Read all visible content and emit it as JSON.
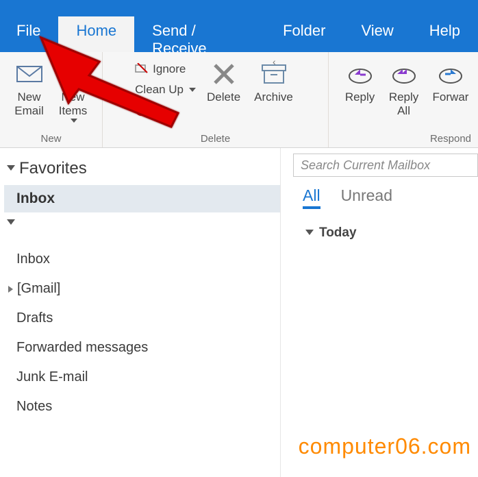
{
  "menu": {
    "file": "File",
    "home": "Home",
    "send_receive": "Send / Receive",
    "folder": "Folder",
    "view": "View",
    "help": "Help",
    "active": "Home"
  },
  "ribbon": {
    "group_new": {
      "label": "New",
      "new_email": "New\nEmail",
      "new_items": "New\nItems"
    },
    "group_delete": {
      "label": "Delete",
      "ignore": "Ignore",
      "cleanup": "Clean Up",
      "junk": "Ju...",
      "delete": "Delete",
      "archive": "Archive"
    },
    "group_respond": {
      "label": "Respond",
      "reply": "Reply",
      "reply_all": "Reply\nAll",
      "forward": "Forwar"
    }
  },
  "folders": {
    "favorites": "Favorites",
    "inbox_fav": "Inbox",
    "items": {
      "inbox": "Inbox",
      "gmail": "[Gmail]",
      "drafts": "Drafts",
      "forwarded": "Forwarded messages",
      "junk": "Junk E-mail",
      "notes": "Notes"
    }
  },
  "msg": {
    "search_placeholder": "Search Current Mailbox",
    "filter_all": "All",
    "filter_unread": "Unread",
    "date_today": "Today"
  },
  "watermark": "computer06.com"
}
